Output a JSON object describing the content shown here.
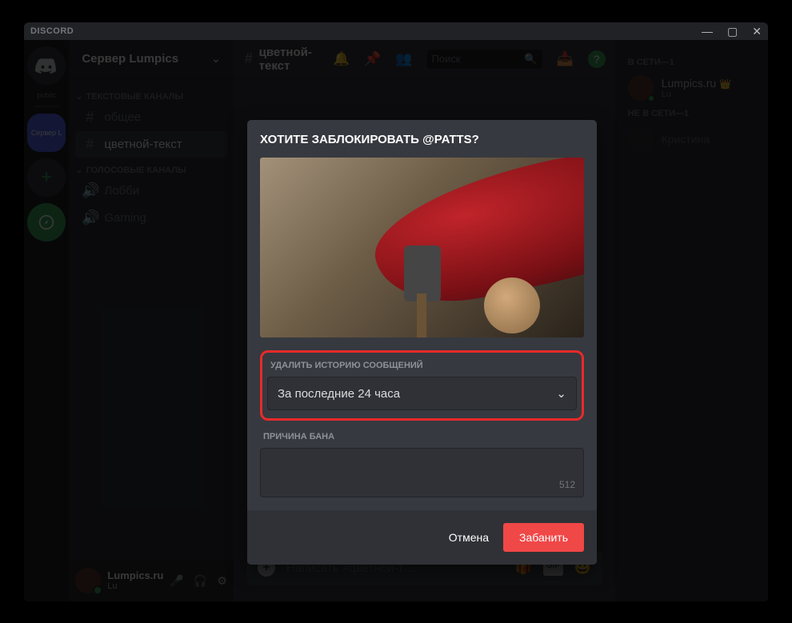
{
  "titlebar": {
    "brand": "DISCORD"
  },
  "servers": {
    "home_label": "public",
    "selected_initials": "Сервер Lumpics"
  },
  "server_header": {
    "name": "Сервер Lumpics"
  },
  "categories": {
    "text": "ТЕКСТОВЫЕ КАНАЛЫ",
    "voice": "ГОЛОСОВЫЕ КАНАЛЫ"
  },
  "channels": {
    "text": [
      "общее",
      "цветной-текст"
    ],
    "voice": [
      "Лобби",
      "Gaming"
    ]
  },
  "user_panel": {
    "name": "Lumpics.ru",
    "disc": "Lu"
  },
  "chat_header": {
    "name": "цветной-текст"
  },
  "search": {
    "placeholder": "Поиск"
  },
  "composer": {
    "placeholder": "Написать #цветной-т…"
  },
  "members": {
    "online_header": "В СЕТИ—1",
    "offline_header": "НЕ В СЕТИ—1",
    "online": {
      "name": "Lumpics.ru",
      "sub": "Lu"
    },
    "offline": {
      "name": "Кристина"
    }
  },
  "modal": {
    "title": "ХОТИТЕ ЗАБЛОКИРОВАТЬ @PATTS?",
    "delete_history_label": "УДАЛИТЬ ИСТОРИЮ СООБЩЕНИЙ",
    "delete_history_value": "За последние 24 часа",
    "reason_label": "ПРИЧИНА БАНА",
    "char_count": "512",
    "cancel": "Отмена",
    "ban": "Забанить"
  }
}
